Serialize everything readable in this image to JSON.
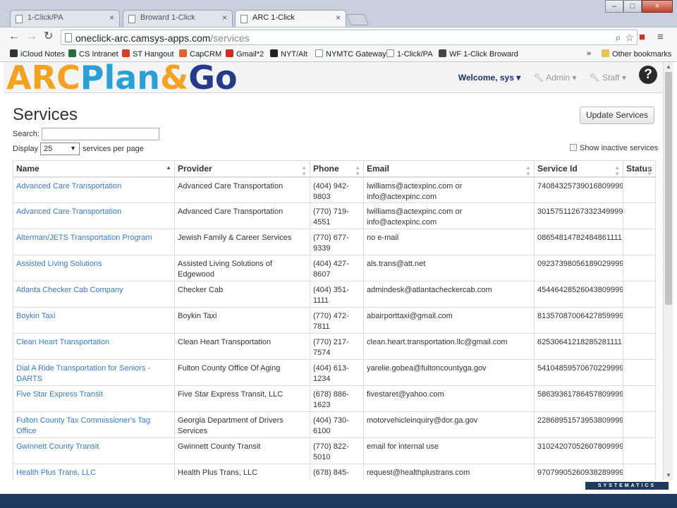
{
  "browser": {
    "tabs": [
      {
        "label": "1-Click/PA"
      },
      {
        "label": "Broward 1-Click"
      },
      {
        "label": "ARC 1-Click"
      }
    ],
    "url_host": "oneclick-arc.camsys-apps.com",
    "url_path": "/services",
    "bookmarks": [
      {
        "label": "iCloud Notes",
        "color": "#333333"
      },
      {
        "label": "CS Intranet",
        "color": "#2e6b3a"
      },
      {
        "label": "ST Hangout",
        "color": "#d93a2b"
      },
      {
        "label": "CapCRM",
        "color": "#e0642a"
      },
      {
        "label": "Gmail*2",
        "color": "#c9302c"
      },
      {
        "label": "NYT/Alt",
        "color": "#222222"
      },
      {
        "label": "NYMTC Gateway",
        "color": "#ffffff"
      },
      {
        "label": "1-Click/PA",
        "color": "#ffffff"
      },
      {
        "label": "WF 1-Click Broward",
        "color": "#444444"
      }
    ],
    "more_bookmarks": "»",
    "other_bookmarks": "Other bookmarks"
  },
  "app": {
    "logo": {
      "part1": "ARC",
      "part2": "Plan",
      "part3": "&",
      "part4": "Go"
    },
    "welcome": "Welcome, sys",
    "admin_menu": "Admin",
    "staff_menu": "Staff",
    "help": "?"
  },
  "page": {
    "title": "Services",
    "update_button": "Update Services",
    "search_label": "Search:",
    "search_value": "",
    "display_label": "Display",
    "display_value": "25",
    "per_page_label": "services per page",
    "show_inactive_label": "Show inactive services"
  },
  "table": {
    "columns": [
      "Name",
      "Provider",
      "Phone",
      "Email",
      "Service Id",
      "Status"
    ],
    "rows": [
      {
        "name": "Advanced Care Transportation",
        "provider": "Advanced Care Transportation",
        "phone": "(404) 942-9803",
        "email": "lwilliams@actexpinc.com or info@actexpinc.com",
        "service_id": "74084325739016809999",
        "status": ""
      },
      {
        "name": "Advanced Care Transportation",
        "provider": "Advanced Care Transportation",
        "phone": "(770) 719-4551",
        "email": "lwilliams@actexpinc.com or info@actexpinc.com",
        "service_id": "30157511267332349999",
        "status": ""
      },
      {
        "name": "Alterman/JETS Transportation Program",
        "provider": "Jewish Family & Career Services",
        "phone": "(770) 677-9339",
        "email": "no e-mail",
        "service_id": "08654814782484861111",
        "status": ""
      },
      {
        "name": "Assisted Living Solutions",
        "provider": "Assisted Living Solutions of Edgewood",
        "phone": "(404) 427-8607",
        "email": "als.trans@att.net",
        "service_id": "09237398056189029999",
        "status": ""
      },
      {
        "name": "Atlanta Checker Cab Company",
        "provider": "Checker Cab",
        "phone": "(404) 351-1111",
        "email": "admindesk@atlantacheckercab.com",
        "service_id": "45446428526043809999",
        "status": ""
      },
      {
        "name": "Boykin Taxi",
        "provider": "Boykin Taxi",
        "phone": "(770) 472-7811",
        "email": "abairporttaxi@gmail.com",
        "service_id": "81357087006427859999",
        "status": ""
      },
      {
        "name": "Clean Heart Transportation",
        "provider": "Clean Heart Transportation",
        "phone": "(770) 217-7574",
        "email": "clean.heart.transportation.llc@gmail.com",
        "service_id": "62530641218285281111",
        "status": ""
      },
      {
        "name": "Dial A Ride Transportation for Seniors - DARTS",
        "provider": "Fulton County Office Of Aging",
        "phone": "(404) 613-1234",
        "email": "yarelie.gobea@fultoncountyga.gov",
        "service_id": "54104859570670229999",
        "status": ""
      },
      {
        "name": "Five Star Express Transit",
        "provider": "Five Star Express Transit, LLC",
        "phone": "(678) 886-1623",
        "email": "fivestaret@yahoo.com",
        "service_id": "58639361786457809999",
        "status": ""
      },
      {
        "name": "Fulton County Tax Commissioner's Tag Office",
        "provider": "Georgia Department of Drivers Services",
        "phone": "(404) 730-6100",
        "email": "motorvehicleinquiry@dor.ga.gov",
        "service_id": "22868951573953809999",
        "status": ""
      },
      {
        "name": "Gwinnett County Transit",
        "provider": "Gwinnett County Transit",
        "phone": "(770) 822-5010",
        "email": "email for internal use",
        "service_id": "31024207052607809999",
        "status": ""
      },
      {
        "name": "Health Plus Trans, LLC",
        "provider": "Health Plus Trans, LLC",
        "phone": "(678) 845-",
        "email": "request@healthplustrans.com",
        "service_id": "97079905260938289999",
        "status": ""
      }
    ]
  },
  "footer": {
    "brand": "SYSTEMATICS"
  }
}
